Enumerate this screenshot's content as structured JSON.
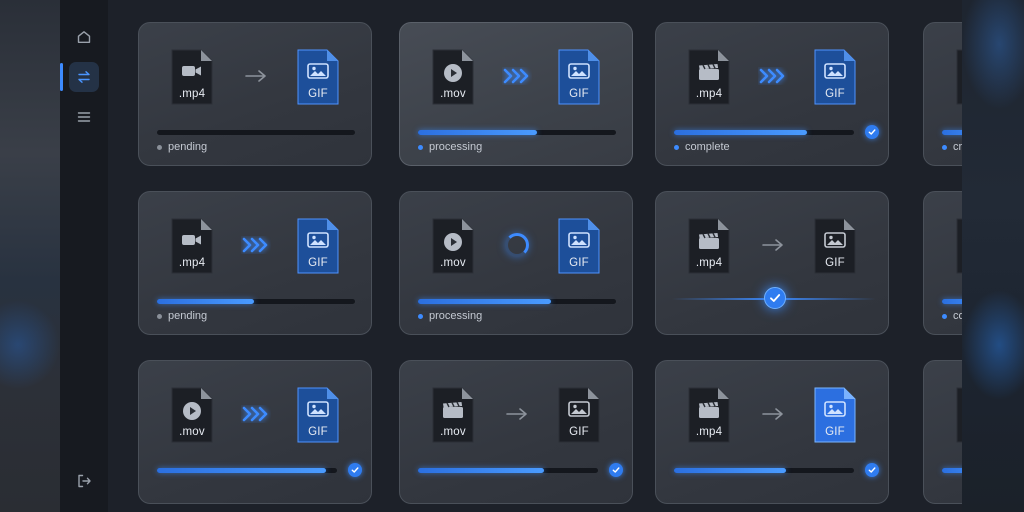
{
  "nav": {
    "items": [
      {
        "name": "home-icon",
        "active": false
      },
      {
        "name": "convert-arrows-icon",
        "active": true
      },
      {
        "name": "menu-icon",
        "active": false
      }
    ],
    "bottom": {
      "name": "logout-icon"
    }
  },
  "colors": {
    "accent": "#3d8bff",
    "background": "#1d2129",
    "card": "#363a42"
  },
  "output_format": "GIF",
  "cards": [
    {
      "source": ".mp4",
      "source_icon": "video-camera-icon",
      "output": "GIF",
      "arrow": "plain",
      "progress": 0,
      "status": "pending",
      "status_visible": true,
      "check": false,
      "output_style": "blue"
    },
    {
      "source": ".mov",
      "source_icon": "play-circle-icon",
      "output": "GIF",
      "arrow": "chevrons",
      "progress": 0.6,
      "status": "processing",
      "status_visible": true,
      "check": false,
      "output_style": "blue",
      "highlight": true
    },
    {
      "source": ".mp4",
      "source_icon": "clapperboard-icon",
      "output": "GIF",
      "arrow": "chevrons",
      "progress": 0.74,
      "status": "complete",
      "status_visible": true,
      "check": true,
      "output_style": "blue"
    },
    {
      "source": ".mp4",
      "source_icon": "video-camera-icon",
      "output": "GIF",
      "arrow": "chevrons",
      "progress": 0.49,
      "status": "pending",
      "status_visible": true,
      "check": false,
      "output_style": "blue"
    },
    {
      "source": ".mov",
      "source_icon": "play-circle-icon",
      "output": "GIF",
      "arrow": "spinner",
      "progress": 0.67,
      "status": "processing",
      "status_visible": true,
      "check": false,
      "output_style": "blue"
    },
    {
      "source": ".mp4",
      "source_icon": "clapperboard-icon",
      "output": "GIF",
      "arrow": "plain",
      "progress": 0.5,
      "status": "",
      "status_visible": false,
      "check": false,
      "slider": true,
      "output_style": "dark"
    },
    {
      "source": ".mov",
      "source_icon": "play-circle-icon",
      "output": "GIF",
      "arrow": "chevrons",
      "progress": 0.94,
      "status": "",
      "status_visible": false,
      "check": true,
      "output_style": "blue"
    },
    {
      "source": ".mov",
      "source_icon": "clapperboard-icon",
      "output": "GIF",
      "arrow": "plain",
      "progress": 0.7,
      "status": "",
      "status_visible": false,
      "check": true,
      "output_style": "dark"
    },
    {
      "source": ".mp4",
      "source_icon": "clapperboard-icon",
      "output": "GIF",
      "arrow": "plain",
      "progress": 0.62,
      "status": "",
      "status_visible": false,
      "check": true,
      "output_style": "glow"
    }
  ],
  "partial_cards": [
    {
      "source": ".m",
      "status": "cr"
    },
    {
      "source": ".",
      "status": "co"
    },
    {
      "source": "",
      "status": ""
    }
  ]
}
